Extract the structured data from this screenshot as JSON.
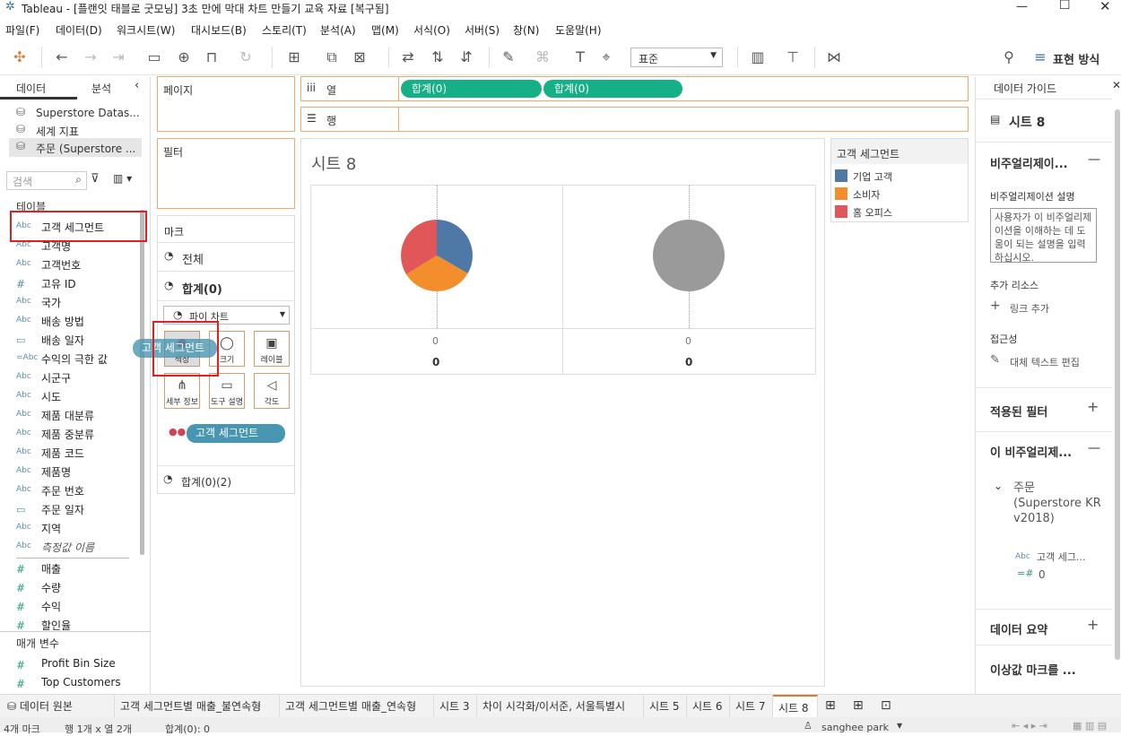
{
  "window": {
    "title": "Tableau - [플랜잇 태블로 굿모닝] 3초 만에 막대 차트 만들기 교육 자료 [복구됨]"
  },
  "menu": [
    "파일(F)",
    "데이터(D)",
    "워크시트(W)",
    "대시보드(B)",
    "스토리(T)",
    "분석(A)",
    "맵(M)",
    "서식(O)",
    "서버(S)",
    "창(N)",
    "도움말(H)"
  ],
  "toolbar": {
    "fit_select": "표준",
    "show_me": "표현 방식"
  },
  "left": {
    "tab_data": "데이터",
    "tab_analysis": "분석",
    "sources": [
      "Superstore Datas...",
      "세계 지표",
      "주문 (Superstore ..."
    ],
    "search_placeholder": "검색",
    "tables_header": "테이블",
    "dimensions": [
      {
        "icon": "Abc",
        "label": "고객 세그먼트"
      },
      {
        "icon": "Abc",
        "label": "고객명"
      },
      {
        "icon": "Abc",
        "label": "고객번호"
      },
      {
        "icon": "#",
        "label": "고유 ID"
      },
      {
        "icon": "Abc",
        "label": "국가"
      },
      {
        "icon": "Abc",
        "label": "배송 방법"
      },
      {
        "icon": "cal",
        "label": "배송 일자"
      },
      {
        "icon": "=Abc",
        "label": "수익의 극한 값"
      },
      {
        "icon": "Abc",
        "label": "시군구"
      },
      {
        "icon": "Abc",
        "label": "시도"
      },
      {
        "icon": "Abc",
        "label": "제품 대분류"
      },
      {
        "icon": "Abc",
        "label": "제품 중분류"
      },
      {
        "icon": "Abc",
        "label": "제품 코드"
      },
      {
        "icon": "Abc",
        "label": "제품명"
      },
      {
        "icon": "Abc",
        "label": "주문 번호"
      },
      {
        "icon": "cal",
        "label": "주문 일자"
      },
      {
        "icon": "Abc",
        "label": "지역"
      },
      {
        "icon": "Abc",
        "label": "측정값 이름"
      }
    ],
    "measures": [
      "매출",
      "수량",
      "수익",
      "할인율"
    ],
    "params_header": "매개 변수",
    "params": [
      "Profit Bin Size",
      "Top Customers"
    ]
  },
  "shelves": {
    "pages": "페이지",
    "filters": "필터",
    "marks": "마크",
    "marks_all": "전체",
    "marks_sum": "합계(0)",
    "mark_type": "파이 차트",
    "btn_color": "색상",
    "btn_size": "크기",
    "btn_label": "레이블",
    "btn_detail": "세부 정보",
    "btn_tooltip": "도구 설명",
    "btn_angle": "각도",
    "color_pill": "고객 세그먼트",
    "drag_ghost": "고객 세그먼트",
    "marks_sum2": "합계(0)(2)",
    "columns": "열",
    "rows": "행",
    "col_pill1": "합계(0)",
    "col_pill2": "합계(0)"
  },
  "view": {
    "title": "시트 8",
    "axis_tick1": "0",
    "axis_tick2": "0",
    "axis_label1": "0",
    "axis_label2": "0",
    "pie_colors": {
      "corporate": "#4e79a7",
      "consumer": "#f28e2b",
      "home_office": "#e15759",
      "grey": "#9a9a9a"
    }
  },
  "legend": {
    "title": "고객 세그먼트",
    "items": [
      {
        "label": "기업 고객",
        "color": "#4e79a7"
      },
      {
        "label": "소비자",
        "color": "#f28e2b"
      },
      {
        "label": "홈 오피스",
        "color": "#e15759"
      }
    ]
  },
  "right": {
    "header": "데이터 가이드",
    "sheet": "시트 8",
    "viz_section": "비주얼리제이...",
    "desc_label": "비주얼리제이션 설명",
    "desc_placeholder": "사용자가 이 비주얼리제이션을 이해하는 데 도움이 되는 설명을 입력하십시오.",
    "resources": "추가 리소스",
    "add_link": "링크 추가",
    "accessibility": "접근성",
    "alt_text": "대체 텍스트 편집",
    "applied_filters": "적용된 필터",
    "viz_data": "이 비주얼리제...",
    "source_name": "주문 (Superstore KR v2018)",
    "field1": "고객 세그...",
    "field2": "0",
    "data_summary": "데이터 요약",
    "outliers": "이상값 마크를 ..."
  },
  "tabs": [
    "데이터 원본",
    "고객 세그먼트별 매출_불연속형",
    "고객 세그먼트별 매출_연속형",
    "시트 3",
    "차이 시각화/이서준, 서울특별시",
    "시트 5",
    "시트 6",
    "시트 7",
    "시트 8"
  ],
  "status": {
    "marks": "4개 마크",
    "rows_cols": "행 1개 x 열 2개",
    "sum": "합계(0): 0",
    "user": "sanghee park"
  }
}
